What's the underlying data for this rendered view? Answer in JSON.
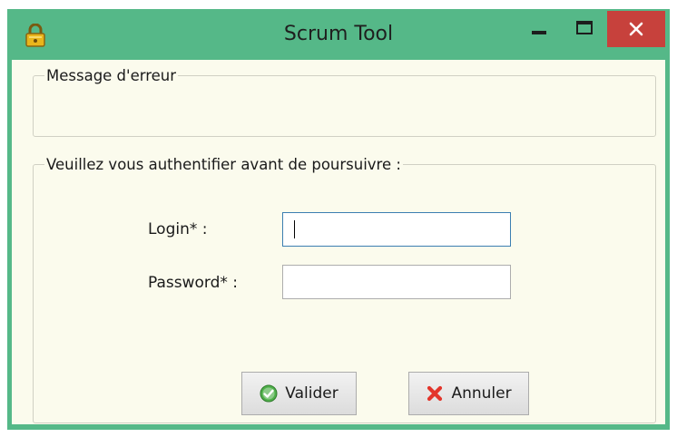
{
  "window": {
    "title": "Scrum Tool",
    "app_icon": "lock-icon",
    "controls": {
      "minimize": "minimize-icon",
      "maximize": "maximize-icon",
      "close": "close-icon"
    },
    "colors": {
      "frame": "#55b888",
      "close": "#c7413c",
      "client": "#fbfbed"
    }
  },
  "error_group": {
    "legend": "Message d'erreur"
  },
  "auth_group": {
    "legend": "Veuillez vous authentifier avant de poursuivre :",
    "login_label": "Login* :",
    "login_value": "",
    "password_label": "Password* :",
    "password_value": ""
  },
  "buttons": {
    "validate_label": "Valider",
    "validate_icon": "check-circle-icon",
    "cancel_label": "Annuler",
    "cancel_icon": "cross-icon"
  }
}
